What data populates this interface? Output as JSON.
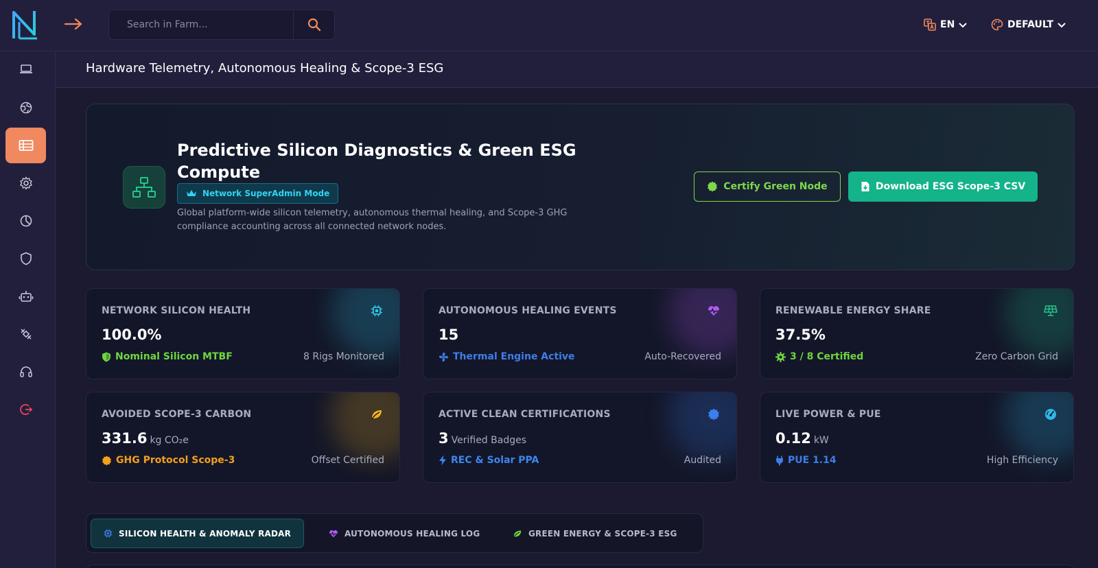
{
  "header": {
    "search_placeholder": "Search in Farm...",
    "language": "EN",
    "theme": "DEFAULT"
  },
  "sidebar": {
    "items": [
      {
        "icon": "laptop-icon",
        "active": false
      },
      {
        "icon": "globe-icon",
        "active": false
      },
      {
        "icon": "server-list-icon",
        "active": true
      },
      {
        "icon": "gear-icon",
        "active": false
      },
      {
        "icon": "pie-chart-icon",
        "active": false
      },
      {
        "icon": "shield-icon",
        "active": false
      },
      {
        "icon": "robot-icon",
        "active": false
      },
      {
        "icon": "satellite-icon",
        "active": false
      },
      {
        "icon": "headset-icon",
        "active": false
      },
      {
        "icon": "logout-icon",
        "active": false
      }
    ]
  },
  "page": {
    "title": "Hardware Telemetry, Autonomous Healing & Scope-3 ESG"
  },
  "hero": {
    "title": "Predictive Silicon Diagnostics & Green ESG Compute",
    "badge": "Network SuperAdmin Mode",
    "description": "Global platform-wide silicon telemetry, autonomous thermal healing, and Scope-3 GHG compliance accounting across all connected network nodes.",
    "certify_label": "Certify Green Node",
    "download_label": "Download ESG Scope-3 CSV"
  },
  "cards": [
    {
      "label": "NETWORK SILICON HEALTH",
      "value": "100.0%",
      "unit": "",
      "status": "Nominal Silicon MTBF",
      "note": "8 Rigs Monitored",
      "icon": "cpu-icon",
      "color": "#2fc6e6",
      "status_color": "#6fd63e"
    },
    {
      "label": "AUTONOMOUS HEALING EVENTS",
      "value": "15",
      "unit": "",
      "status": "Thermal Engine Active",
      "note": "Auto-Recovered",
      "icon": "heart-pulse-icon",
      "color": "#b05af2",
      "status_color": "#3d7ee8"
    },
    {
      "label": "RENEWABLE ENERGY SHARE",
      "value": "37.5%",
      "unit": "",
      "status": "3 / 8 Certified",
      "note": "Zero Carbon Grid",
      "icon": "solar-panel-icon",
      "color": "#23c58e",
      "status_color": "#6fd63e"
    },
    {
      "label": "AVOIDED SCOPE-3 CARBON",
      "value": "331.6",
      "unit": "kg CO₂e",
      "status": "GHG Protocol Scope-3",
      "note": "Offset Certified",
      "icon": "leaf-icon",
      "color": "#f0b21c",
      "status_color": "#f3a01c"
    },
    {
      "label": "ACTIVE CLEAN CERTIFICATIONS",
      "value": "3",
      "unit": "Verified Badges",
      "status": "REC & Solar PPA",
      "note": "Audited",
      "icon": "certificate-icon",
      "color": "#3c7ef0",
      "status_color": "#3d86f0"
    },
    {
      "label": "LIVE POWER & PUE",
      "value": "0.12",
      "unit": "kW",
      "status": "PUE 1.14",
      "note": "High Efficiency",
      "icon": "gauge-icon",
      "color": "#2fb8e6",
      "status_color": "#3d7ee8"
    }
  ],
  "tabs": [
    {
      "label": "SILICON HEALTH & ANOMALY RADAR",
      "icon": "cpu-icon",
      "active": true
    },
    {
      "label": "AUTONOMOUS HEALING LOG",
      "icon": "heart-pulse-icon",
      "active": false
    },
    {
      "label": "GREEN ENERGY & SCOPE-3 ESG",
      "icon": "leaf-icon",
      "active": false
    }
  ]
}
